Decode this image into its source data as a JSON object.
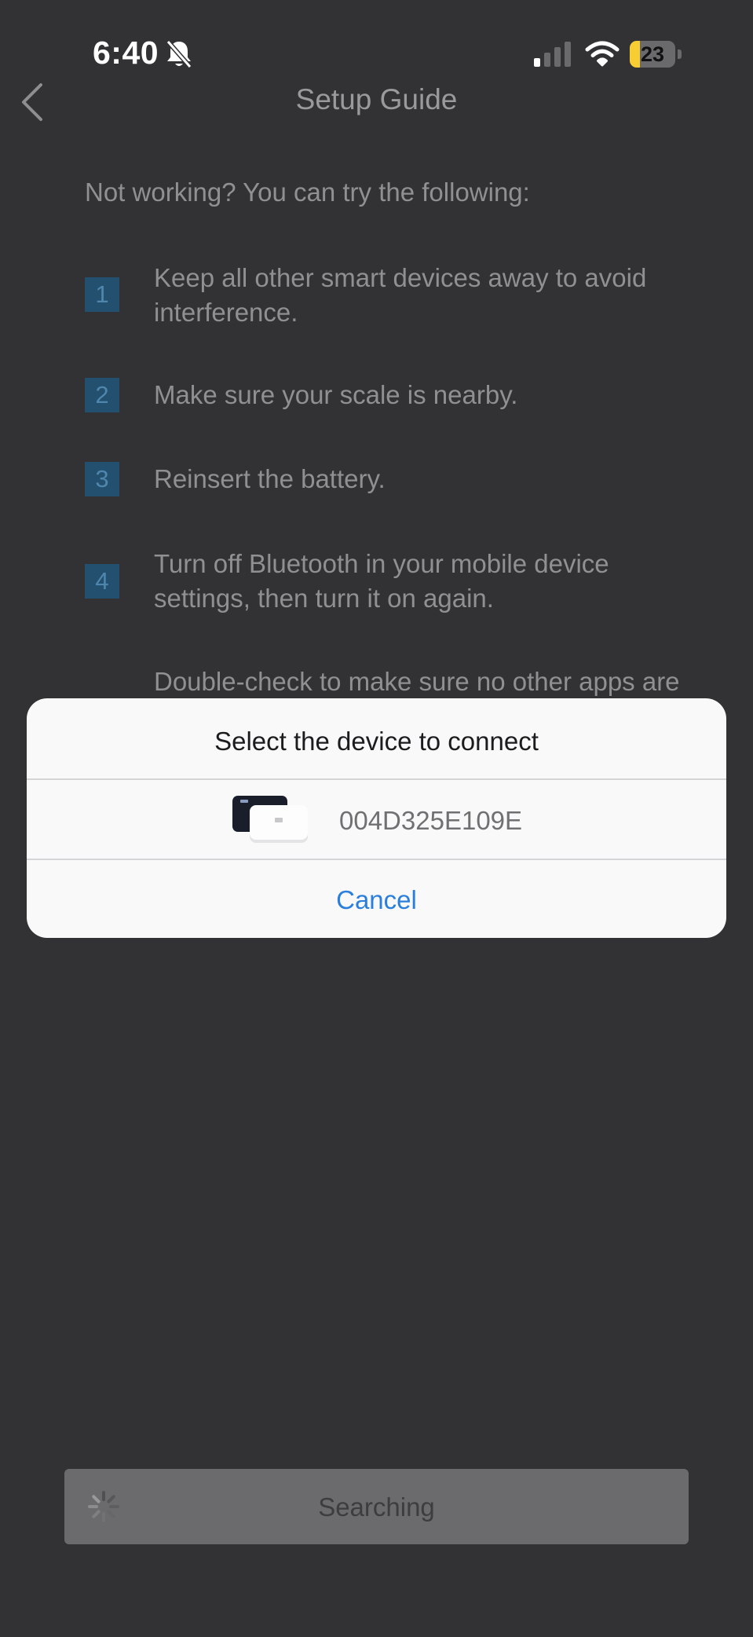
{
  "status_bar": {
    "time": "6:40",
    "battery_level": "23",
    "battery_fraction": 0.23,
    "icons": [
      "bell-slash-icon",
      "cellular-signal-icon",
      "wifi-icon",
      "battery-icon"
    ]
  },
  "nav": {
    "back_icon": "chevron-left-icon",
    "title": "Setup Guide"
  },
  "guide": {
    "intro": "Not working? You can try the following:",
    "steps": [
      {
        "number": "1",
        "text": "Keep all other smart devices away to avoid interference."
      },
      {
        "number": "2",
        "text": "Make sure your scale is nearby."
      },
      {
        "number": "3",
        "text": "Reinsert the battery."
      },
      {
        "number": "4",
        "text": "Turn off Bluetooth in your mobile device settings, then turn it on again."
      },
      {
        "number": "",
        "text": "Double-check to make sure no other apps are"
      }
    ]
  },
  "dialog": {
    "title": "Select the device to connect",
    "device": {
      "id": "004D325E109E",
      "image": "scale-image"
    },
    "cancel_label": "Cancel"
  },
  "bottom_button": {
    "label": "Searching",
    "icon": "spinner-icon"
  },
  "colors": {
    "background": "#323234",
    "step_badge": "#24506f",
    "dialog_background": "#f9f9f9",
    "link": "#2b7fdc",
    "search_button": "#6b6b6d",
    "battery_fill": "#f7cd31"
  }
}
